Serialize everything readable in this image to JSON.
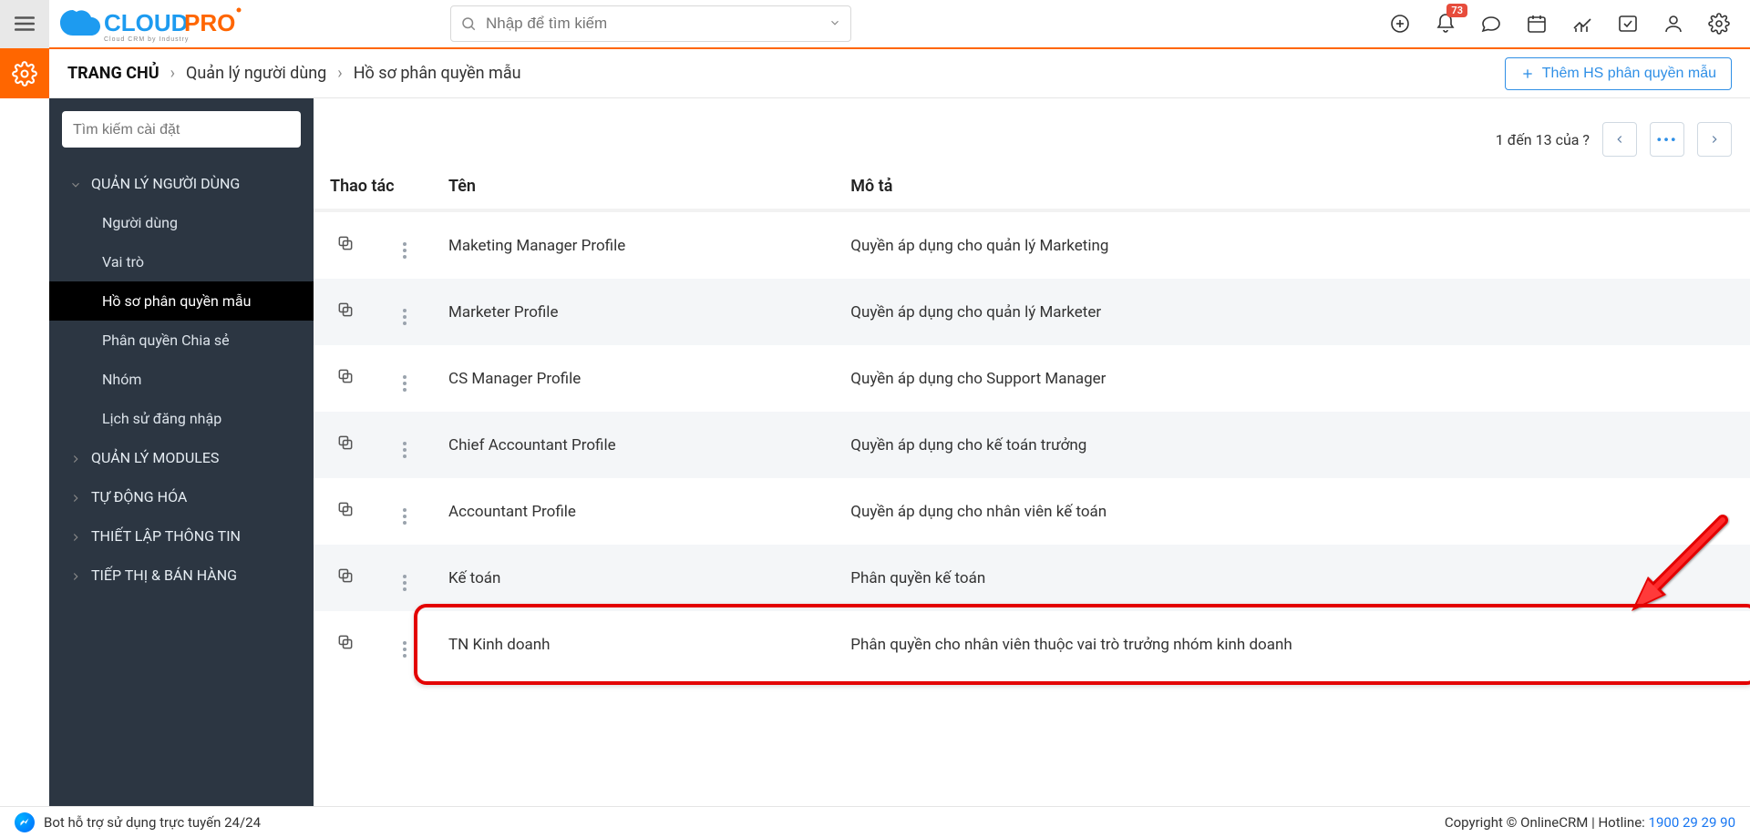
{
  "header": {
    "logo_text_1": "CLOUD",
    "logo_text_2": "PRO",
    "logo_tagline": "Cloud CRM by Industry",
    "search_placeholder": "Nhập để tìm kiếm",
    "notification_count": "73"
  },
  "breadcrumb": {
    "home": "TRANG CHỦ",
    "level1": "Quản lý người dùng",
    "level2": "Hồ sơ phân quyền mẫu",
    "add_button": "Thêm HS phân quyền mẫu"
  },
  "sidebar": {
    "search_placeholder": "Tìm kiếm cài đặt",
    "groups": [
      {
        "label": "QUẢN LÝ NGƯỜI DÙNG",
        "expanded": true,
        "items": [
          {
            "label": "Người dùng",
            "active": false
          },
          {
            "label": "Vai trò",
            "active": false
          },
          {
            "label": "Hồ sơ phân quyền mẫu",
            "active": true
          },
          {
            "label": "Phân quyền Chia sẻ",
            "active": false
          },
          {
            "label": "Nhóm",
            "active": false
          },
          {
            "label": "Lịch sử đăng nhập",
            "active": false
          }
        ]
      },
      {
        "label": "QUẢN LÝ MODULES",
        "expanded": false
      },
      {
        "label": "TỰ ĐỘNG HÓA",
        "expanded": false
      },
      {
        "label": "THIẾT LẬP THÔNG TIN",
        "expanded": false
      },
      {
        "label": "TIẾP THỊ & BÁN HÀNG",
        "expanded": false
      }
    ]
  },
  "table": {
    "pager_text": "1 đến 13 của  ?",
    "columns": {
      "actions": "Thao tác",
      "name": "Tên",
      "desc": "Mô tả"
    },
    "rows": [
      {
        "name": "Maketing Manager Profile",
        "desc": "Quyền áp dụng cho quản lý Marketing"
      },
      {
        "name": "Marketer Profile",
        "desc": "Quyền áp dụng cho quản lý Marketer"
      },
      {
        "name": "CS Manager Profile",
        "desc": "Quyền áp dụng cho Support Manager"
      },
      {
        "name": "Chief Accountant Profile",
        "desc": "Quyền áp dụng cho kế toán trưởng"
      },
      {
        "name": "Accountant Profile",
        "desc": "Quyền áp dụng cho nhân viên kế toán"
      },
      {
        "name": "Kế toán",
        "desc": "Phân quyền kế toán"
      },
      {
        "name": "TN Kinh doanh",
        "desc": "Phân quyền cho nhân viên thuộc vai trò trưởng nhóm kinh doanh"
      }
    ],
    "highlight_index": 6
  },
  "footer": {
    "bot_text": "Bot hỗ trợ sử dụng trực tuyến 24/24",
    "copyright_prefix": "Copyright © OnlineCRM",
    "hotline_label": "Hotline: ",
    "hotline_number": "1900 29 29 90"
  }
}
